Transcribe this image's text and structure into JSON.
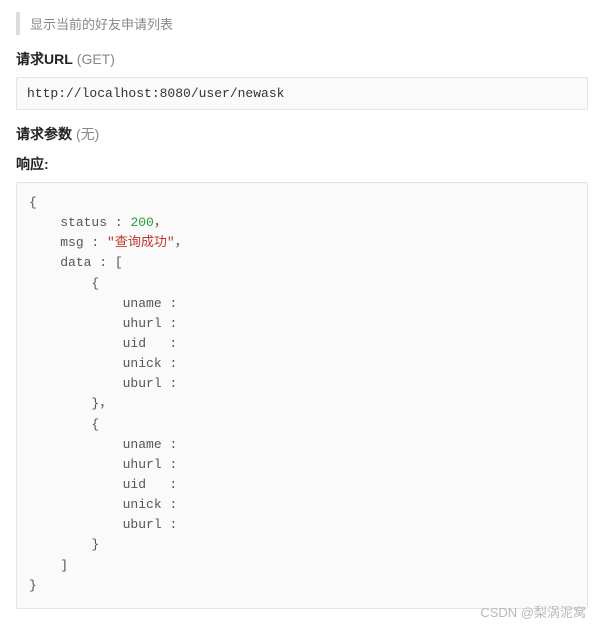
{
  "quote": "显示当前的好友申请列表",
  "sections": {
    "request_url_label": "请求URL",
    "request_url_method": "(GET)",
    "request_params_label": "请求参数",
    "request_params_value": "(无)",
    "response_label": "响应:"
  },
  "url": "http://localhost:8080/user/newask",
  "code": {
    "status_key": "status",
    "status_val": "200",
    "comma": "，",
    "msg_key": "msg",
    "msg_val": "\"查询成功\"",
    "data_key": "data",
    "fields": {
      "uname": "uname",
      "uhurl": "uhurl",
      "uid": "uid",
      "unick": "unick",
      "uburl": "uburl"
    }
  },
  "watermark": "CSDN @梨涡泥窝"
}
